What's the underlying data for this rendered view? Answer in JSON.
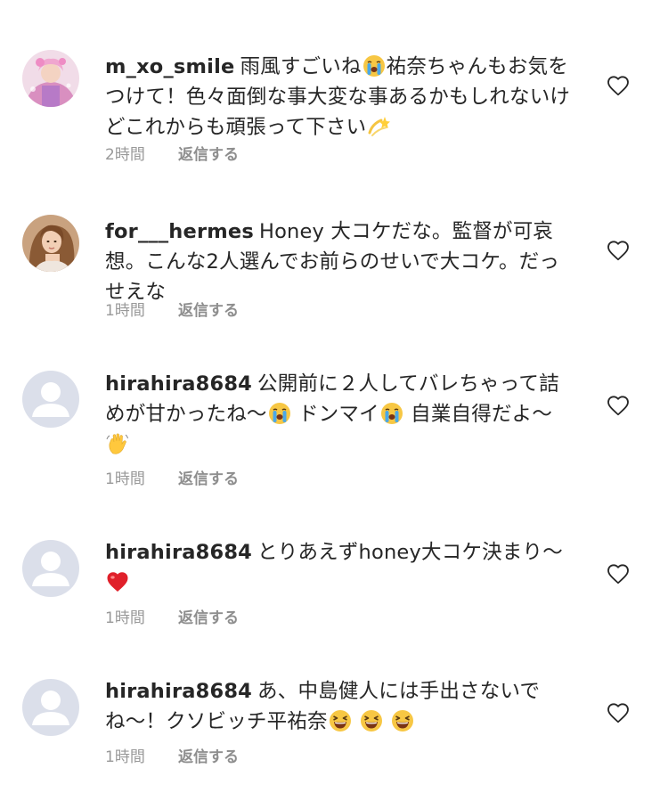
{
  "comments": [
    {
      "username": "m_xo_smile",
      "text_parts": [
        "雨風すごいね",
        "祐奈ちゃんもお気をつけて！色々面倒な事大変な事あるかもしれないけどこれからも頑張って下さい"
      ],
      "emojis": [
        "crying-face",
        "dizzy"
      ],
      "time": "2時間",
      "reply_label": "返信する",
      "avatar": "photo-pink"
    },
    {
      "username": "for___hermes",
      "text_parts": [
        "Honey 大コケだな。監督が可哀想。こんな2人選んでお前らのせいで大コケ。だっせえな"
      ],
      "emojis": [],
      "time": "1時間",
      "reply_label": "返信する",
      "avatar": "photo-brown"
    },
    {
      "username": "hirahira8684",
      "text_parts": [
        "公開前に２人してバレちゃって詰めが甘かったね〜",
        "ドンマイ",
        "自業自得だよ〜"
      ],
      "emojis": [
        "crying-face",
        "crying-face",
        "waving-hand"
      ],
      "time": "1時間",
      "reply_label": "返信する",
      "avatar": "default"
    },
    {
      "username": "hirahira8684",
      "text_parts": [
        "とりあえずhoney大コケ決まり〜"
      ],
      "emojis": [
        "red-heart"
      ],
      "time": "1時間",
      "reply_label": "返信する",
      "avatar": "default"
    },
    {
      "username": "hirahira8684",
      "text_parts": [
        "あ、中島健人には手出さないでね〜！クソビッチ平祐奈"
      ],
      "emojis": [
        "laughing-face",
        "laughing-face",
        "laughing-face"
      ],
      "time": "1時間",
      "reply_label": "返信する",
      "avatar": "default"
    }
  ],
  "colors": {
    "text": "#262626",
    "meta": "#999999",
    "default_avatar_bg": "#dbdfea",
    "default_avatar_figure": "#ffffff"
  },
  "icons": {
    "like": "heart-outline-icon"
  }
}
